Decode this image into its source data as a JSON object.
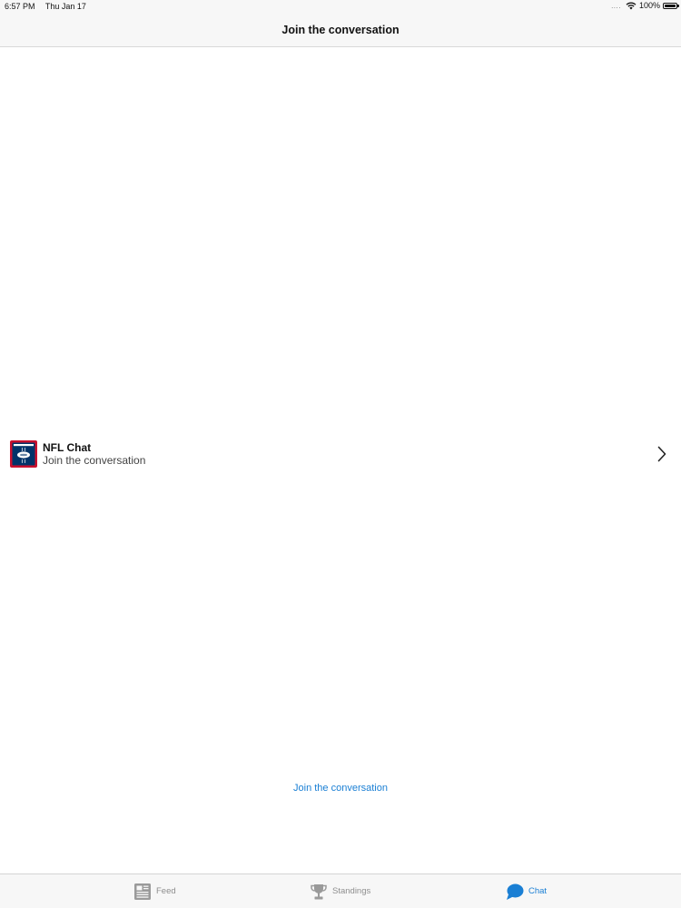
{
  "status_bar": {
    "time": "6:57 PM",
    "date": "Thu Jan 17",
    "signal": "....",
    "battery": "100%"
  },
  "nav": {
    "title": "Join the conversation"
  },
  "chat_list": {
    "items": [
      {
        "title": "NFL Chat",
        "subtitle": "Join the conversation",
        "icon": "nfl-logo-icon"
      }
    ]
  },
  "join_link": "Join the conversation",
  "tab_bar": {
    "tabs": [
      {
        "label": "Feed",
        "icon": "newspaper-icon",
        "selected": false
      },
      {
        "label": "Standings",
        "icon": "trophy-icon",
        "selected": false
      },
      {
        "label": "Chat",
        "icon": "chat-bubble-icon",
        "selected": true
      }
    ]
  },
  "colors": {
    "accent": "#1a7fd4",
    "inactive": "#8e8e8e",
    "logo_red": "#c8102e",
    "logo_navy": "#013369"
  }
}
